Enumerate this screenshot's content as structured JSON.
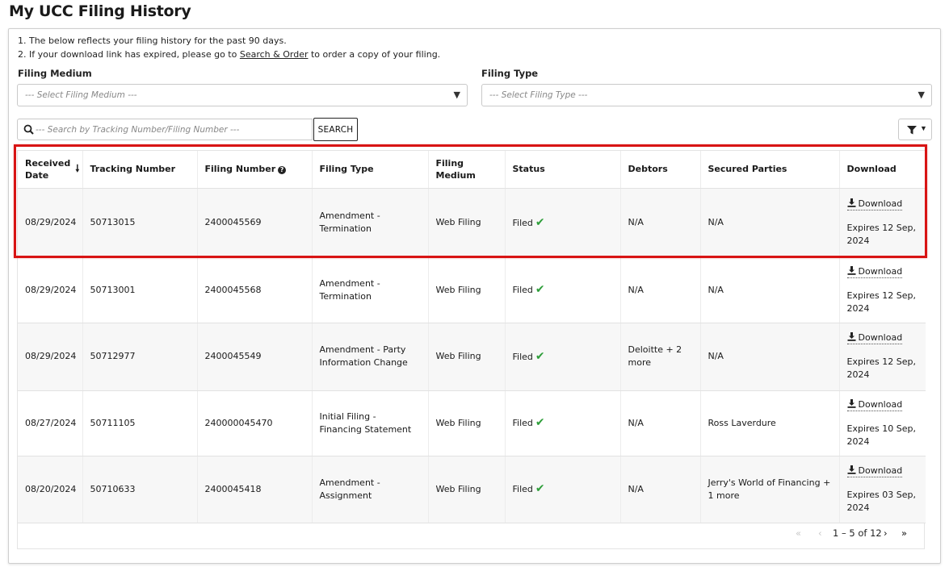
{
  "page": {
    "title": "My UCC Filing History"
  },
  "notes": {
    "line1": "1. The below reflects your filing history for the past 90 days.",
    "line2_prefix": "2. If your download link has expired, please go to ",
    "line2_link": "Search & Order",
    "line2_suffix": " to order a copy of your filing."
  },
  "filters": {
    "filing_medium": {
      "label": "Filing Medium",
      "placeholder": "--- Select Filing Medium ---"
    },
    "filing_type": {
      "label": "Filing Type",
      "placeholder": "--- Select Filing Type ---"
    },
    "search": {
      "placeholder": "--- Search by Tracking Number/Filing Number ---",
      "value": "",
      "button_label": "SEARCH"
    }
  },
  "table": {
    "columns": {
      "received_date": "Received Date",
      "tracking_number": "Tracking Number",
      "filing_number": "Filing Number",
      "filing_type": "Filing Type",
      "filing_medium": "Filing Medium",
      "status": "Status",
      "debtors": "Debtors",
      "secured_parties": "Secured Parties",
      "download": "Download"
    },
    "rows": [
      {
        "received_date": "08/29/2024",
        "tracking_number": "50713015",
        "filing_number": "2400045569",
        "filing_type": "Amendment - Termination",
        "filing_medium": "Web Filing",
        "status": "Filed",
        "debtors": "N/A",
        "secured_parties": "N/A",
        "download_label": "Download",
        "expires": "Expires 12 Sep, 2024"
      },
      {
        "received_date": "08/29/2024",
        "tracking_number": "50713001",
        "filing_number": "2400045568",
        "filing_type": "Amendment - Termination",
        "filing_medium": "Web Filing",
        "status": "Filed",
        "debtors": "N/A",
        "secured_parties": "N/A",
        "download_label": "Download",
        "expires": "Expires 12 Sep, 2024"
      },
      {
        "received_date": "08/29/2024",
        "tracking_number": "50712977",
        "filing_number": "2400045549",
        "filing_type": "Amendment - Party Information Change",
        "filing_medium": "Web Filing",
        "status": "Filed",
        "debtors": "Deloitte + 2 more",
        "secured_parties": "N/A",
        "download_label": "Download",
        "expires": "Expires 12 Sep, 2024"
      },
      {
        "received_date": "08/27/2024",
        "tracking_number": "50711105",
        "filing_number": "240000045470",
        "filing_type": "Initial Filing - Financing Statement",
        "filing_medium": "Web Filing",
        "status": "Filed",
        "debtors": "N/A",
        "secured_parties": "Ross Laverdure",
        "download_label": "Download",
        "expires": "Expires 10 Sep, 2024"
      },
      {
        "received_date": "08/20/2024",
        "tracking_number": "50710633",
        "filing_number": "2400045418",
        "filing_type": "Amendment - Assignment",
        "filing_medium": "Web Filing",
        "status": "Filed",
        "debtors": "N/A",
        "secured_parties": "Jerry's World of Financing + 1 more",
        "download_label": "Download",
        "expires": "Expires 03 Sep, 2024"
      }
    ]
  },
  "pagination": {
    "range_text": "1 – 5 of 12"
  },
  "colors": {
    "highlight": "#d81414",
    "status_check": "#2e9e3a"
  },
  "icons": [
    "search-icon",
    "filter-icon",
    "sort-down-icon",
    "info-icon",
    "checkmark-icon",
    "download-icon",
    "first-page-icon",
    "prev-page-icon",
    "next-page-icon",
    "last-page-icon"
  ]
}
